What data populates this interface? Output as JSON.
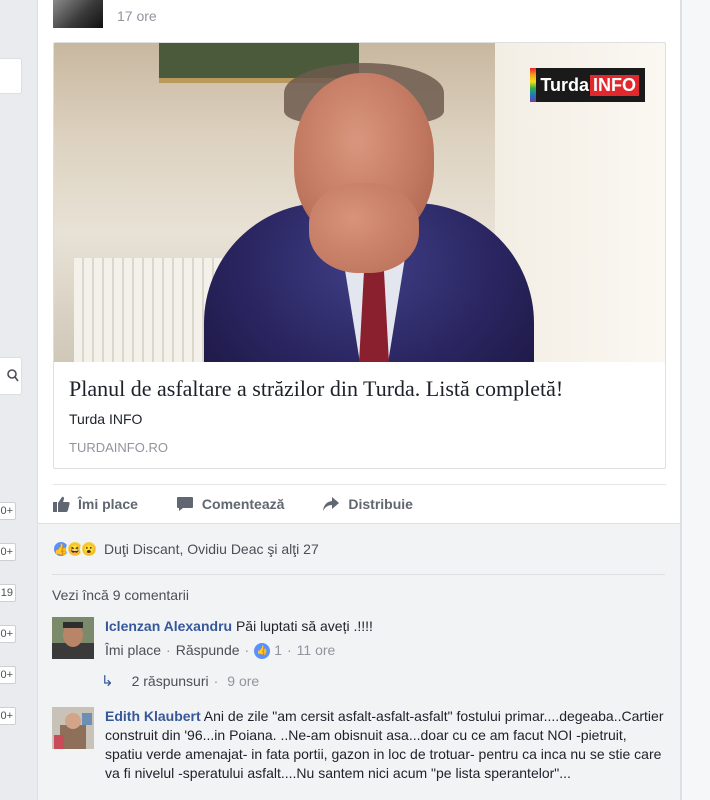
{
  "post": {
    "timestamp": "17 ore",
    "link": {
      "brand_word1": "Turda",
      "brand_word2": "INFO",
      "title": "Planul de asfaltare a străzilor din Turda. Listă completă!",
      "source": "Turda INFO",
      "domain": "TURDAINFO.RO"
    },
    "actions": {
      "like": "Îmi place",
      "comment": "Comentează",
      "share": "Distribuie"
    },
    "reactions_text": "Duţi Discant, Ovidiu Deac şi alţi 27",
    "view_more_comments": "Vezi încă 9 comentarii",
    "comments": [
      {
        "author": "Iclenzan Alexandru",
        "text": "Păi luptati să aveți .!!!!",
        "like_label": "Îmi place",
        "reply_label": "Răspunde",
        "like_count": "1",
        "time": "11 ore",
        "replies_label": "2 răspunsuri",
        "replies_time": "9 ore"
      },
      {
        "author": "Edith Klaubert",
        "text": "Ani de zile \"am cersit asfalt-asfalt-asfalt\" fostului primar....degeaba..Cartier construit din '96...in Poiana. ..Ne-am obisnuit asa...doar cu ce am facut NOI -pietruit, spatiu verde amenajat- in fata portii, gazon in loc de trotuar- pentru ca inca nu se stie care va fi nivelul -speratului asfalt....Nu santem nici acum \"pe lista sperantelor\"..."
      }
    ]
  },
  "sidebar_badges": [
    "0+",
    "0+",
    "19",
    "0+",
    "0+",
    "0+"
  ]
}
